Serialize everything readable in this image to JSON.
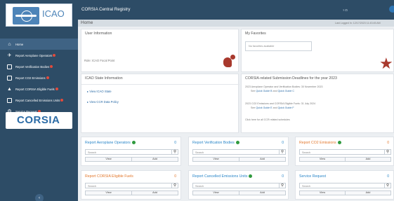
{
  "brand": {
    "org_name": "ICAO",
    "program_logo": "CORSIA"
  },
  "header": {
    "app_title": "CORSIA Central Registry",
    "page_title": "Home",
    "last_logged_label": "Last Logged In: 12/17/2023 11:43:45 AM"
  },
  "sidebar": {
    "toggle_icon": "chevron-left-icon",
    "items": [
      {
        "label": "Home",
        "icon": "home-icon",
        "alert": false,
        "active": true
      },
      {
        "label": "Report Aeroplane Operators",
        "icon": "plane-icon",
        "alert": true
      },
      {
        "label": "Report Verification Bodies",
        "icon": "document-icon",
        "alert": true
      },
      {
        "label": "Report CO2 Emissions",
        "icon": "document-icon",
        "alert": true
      },
      {
        "label": "Report CORSIA Eligible Fuels",
        "icon": "fuel-icon",
        "alert": true
      },
      {
        "label": "Report Cancelled Emissions Units",
        "icon": "document-icon",
        "alert": true
      },
      {
        "label": "Service Request",
        "icon": "gear-icon",
        "alert": true
      }
    ]
  },
  "user_info": {
    "title": "User Information",
    "line": "Role: ICAO Focal Point"
  },
  "favorites": {
    "title": "My Favorites",
    "empty_text": "No favorites available"
  },
  "state_info": {
    "title": "ICAO State Information",
    "links": [
      "View ICAO State",
      "View CCR Data Policy"
    ]
  },
  "deadlines": {
    "title": "CORSIA-related Submission Deadlines for the year 2023",
    "item1_line1": "2023 Aeroplane Operator and Verification Bodies: 30 November 2023",
    "item1_see": "See",
    "item1_guide_a": "Quick Guide B",
    "item1_and": "and",
    "item1_guide_b": "Quick Guide C",
    "item2_line1": "2023 CO2 Emissions and CORSIA Eligible Fuels: 31 July 2024",
    "item2_see": "See",
    "item2_guide_a": "Quick Guide E",
    "item2_and": "and",
    "item2_guide_b": "Quick Guide F",
    "footer": "Click here for all CCR related schedules"
  },
  "cards": [
    {
      "title": "Report Aeroplane Operators",
      "count": "0",
      "color": "blue",
      "search": "Search",
      "view": "View",
      "add": "Add"
    },
    {
      "title": "Report Verification Bodies",
      "count": "0",
      "color": "blue",
      "search": "Search",
      "view": "View",
      "add": "Add"
    },
    {
      "title": "Report CO2 Emissions",
      "count": "0",
      "color": "orange",
      "search": "Search",
      "view": "View",
      "add": "Add"
    },
    {
      "title": "Report CORSIA Eligible Fuels",
      "count": "0",
      "color": "orange",
      "search": "Search",
      "view": "View",
      "add": "Add"
    },
    {
      "title": "Report Cancelled Emissions Units",
      "count": "0",
      "color": "blue",
      "search": "Search",
      "view": "View",
      "add": "Add"
    },
    {
      "title": "Service Request",
      "count": "0",
      "color": "blue",
      "search": "Search",
      "view": "View",
      "add": "Add"
    }
  ],
  "colors": {
    "sidebar_bg": "#2d4c66",
    "accent_blue": "#2a86c8",
    "accent_orange": "#e2772c",
    "alert_red": "#e24a3b",
    "status_green": "#2f9a3e"
  }
}
